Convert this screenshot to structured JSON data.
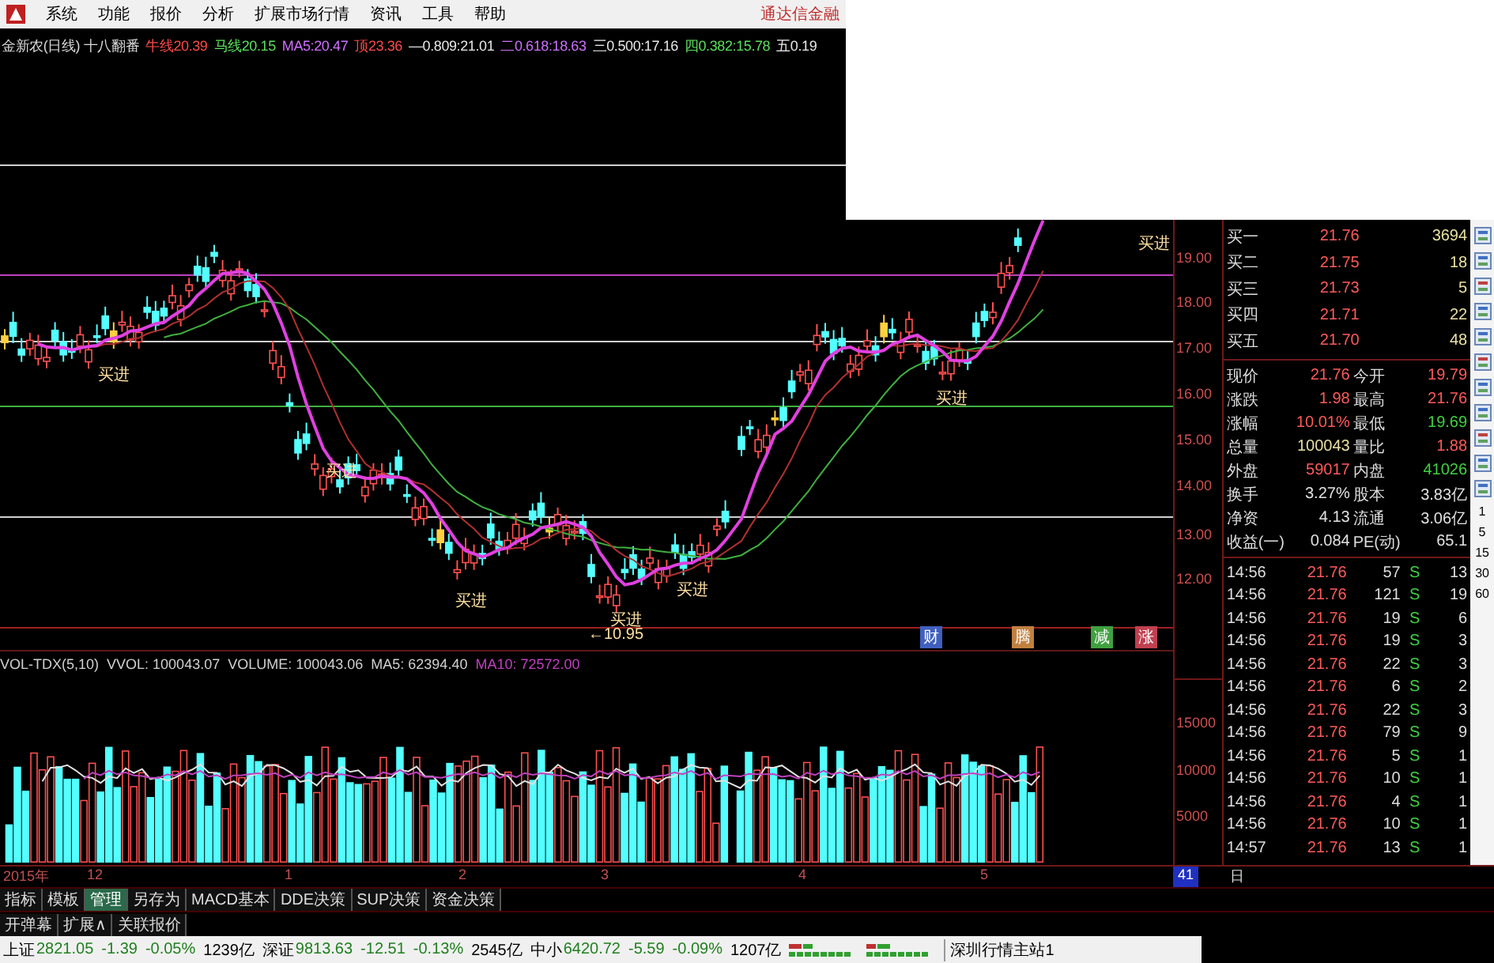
{
  "menu": {
    "items": [
      "系统",
      "功能",
      "报价",
      "分析",
      "扩展市场行情",
      "资讯",
      "工具",
      "帮助"
    ],
    "brand": "通达信金融"
  },
  "info_line": [
    {
      "label": "金新农(日线) 十八翻番",
      "color": "#d8d8d8"
    },
    {
      "label": "牛线",
      "value": "20.39",
      "color": "#ff4a4a"
    },
    {
      "label": "马线",
      "value": "20.15",
      "color": "#5be05b"
    },
    {
      "label": "MA5:",
      "value": "20.47",
      "color": "#d070ff"
    },
    {
      "label": "顶",
      "value": "23.36",
      "color": "#ff4a4a"
    },
    {
      "label": "—0.809:",
      "value": "21.01",
      "color": "#e8e8e8"
    },
    {
      "label": "二0.618:",
      "value": "18.63",
      "color": "#d070ff"
    },
    {
      "label": "三0.500:",
      "value": "17.16",
      "color": "#e8e8e8"
    },
    {
      "label": "四0.382:",
      "value": "15.78",
      "color": "#5be05b"
    },
    {
      "label": "五0.19",
      "color": "#e8e8e8"
    }
  ],
  "price_axis": [
    "19.00",
    "18.00",
    "17.00",
    "16.00",
    "15.00",
    "14.00",
    "13.00",
    "12.00"
  ],
  "chart_labels": [
    "买进",
    "买进",
    "买进",
    "买进",
    "买进",
    "买进",
    "买进",
    "←10.95"
  ],
  "event_markers": [
    {
      "text": "财",
      "color": "#4060c0"
    },
    {
      "text": "腾",
      "color": "#c08040"
    },
    {
      "text": "减",
      "color": "#40a040"
    },
    {
      "text": "涨",
      "color": "#c04050"
    }
  ],
  "volume_header": [
    {
      "text": "VOL-TDX(5,10)",
      "color": "#d0d0d0"
    },
    {
      "text": "VVOL: 100043.07",
      "color": "#d0d0d0"
    },
    {
      "text": "VOLUME: 100043.06",
      "color": "#d0d0d0"
    },
    {
      "text": "MA5: 62394.40",
      "color": "#d0d0d0"
    },
    {
      "text": "MA10: 72572.00",
      "color": "#c040c0"
    }
  ],
  "volume_axis": [
    "15000",
    "10000",
    "5000"
  ],
  "time_axis": [
    "2015年",
    "12",
    "1",
    "2",
    "3",
    "4",
    "5"
  ],
  "period_box": "41",
  "period_unit": "日",
  "order_book": [
    {
      "label": "买一",
      "price": "21.76",
      "volume": "3694"
    },
    {
      "label": "买二",
      "price": "21.75",
      "volume": "18"
    },
    {
      "label": "买三",
      "price": "21.73",
      "volume": "5"
    },
    {
      "label": "买四",
      "price": "21.71",
      "volume": "22"
    },
    {
      "label": "买五",
      "price": "21.70",
      "volume": "48"
    }
  ],
  "stats": [
    {
      "label": "现价",
      "value": {
        "text": "21.76",
        "color": "#ff5a5a"
      },
      "label2": "今开",
      "value2": {
        "text": "19.79",
        "color": "#ff5a5a"
      }
    },
    {
      "label": "涨跌",
      "value": {
        "text": "1.98",
        "color": "#ff5a5a"
      },
      "label2": "最高",
      "value2": {
        "text": "21.76",
        "color": "#ff5a5a"
      }
    },
    {
      "label": "涨幅",
      "value": {
        "text": "10.01%",
        "color": "#ff5a5a"
      },
      "label2": "最低",
      "value2": {
        "text": "19.69",
        "color": "#40d040"
      }
    },
    {
      "label": "总量",
      "value": {
        "text": "100043",
        "color": "#e8e0a0"
      },
      "label2": "量比",
      "value2": {
        "text": "1.88",
        "color": "#ff5a5a"
      }
    },
    {
      "label": "外盘",
      "value": {
        "text": "59017",
        "color": "#ff5a5a"
      },
      "label2": "内盘",
      "value2": {
        "text": "41026",
        "color": "#40d040"
      }
    },
    {
      "label": "换手",
      "value": {
        "text": "3.27%",
        "color": "#e0e0e0"
      },
      "label2": "股本",
      "value2": {
        "text": "3.83亿",
        "color": "#e0e0e0"
      }
    },
    {
      "label": "净资",
      "value": {
        "text": "4.13",
        "color": "#e0e0e0"
      },
      "label2": "流通",
      "value2": {
        "text": "3.06亿",
        "color": "#e0e0e0"
      }
    },
    {
      "label": "收益(一)",
      "value": {
        "text": "0.084",
        "color": "#e0e0e0"
      },
      "label2": "PE(动)",
      "value2": {
        "text": "65.1",
        "color": "#e0e0e0"
      }
    }
  ],
  "ticks": [
    {
      "time": "14:56",
      "price": "21.76",
      "volume": "57",
      "side": "S",
      "color": "#40d040",
      "count": "13"
    },
    {
      "time": "14:56",
      "price": "21.76",
      "volume": "121",
      "side": "S",
      "color": "#40d040",
      "count": "19"
    },
    {
      "time": "14:56",
      "price": "21.76",
      "volume": "19",
      "side": "S",
      "color": "#40d040",
      "count": "6"
    },
    {
      "time": "14:56",
      "price": "21.76",
      "volume": "19",
      "side": "S",
      "color": "#40d040",
      "count": "3"
    },
    {
      "time": "14:56",
      "price": "21.76",
      "volume": "22",
      "side": "S",
      "color": "#40d040",
      "count": "3"
    },
    {
      "time": "14:56",
      "price": "21.76",
      "volume": "6",
      "side": "S",
      "color": "#40d040",
      "count": "2"
    },
    {
      "time": "14:56",
      "price": "21.76",
      "volume": "22",
      "side": "S",
      "color": "#40d040",
      "count": "3"
    },
    {
      "time": "14:56",
      "price": "21.76",
      "volume": "79",
      "side": "S",
      "color": "#40d040",
      "count": "9"
    },
    {
      "time": "14:56",
      "price": "21.76",
      "volume": "5",
      "side": "S",
      "color": "#40d040",
      "count": "1"
    },
    {
      "time": "14:56",
      "price": "21.76",
      "volume": "10",
      "side": "S",
      "color": "#40d040",
      "count": "1"
    },
    {
      "time": "14:56",
      "price": "21.76",
      "volume": "4",
      "side": "S",
      "color": "#40d040",
      "count": "1"
    },
    {
      "time": "14:56",
      "price": "21.76",
      "volume": "10",
      "side": "S",
      "color": "#40d040",
      "count": "1"
    },
    {
      "time": "14:57",
      "price": "21.76",
      "volume": "13",
      "side": "S",
      "color": "#40d040",
      "count": "1"
    }
  ],
  "side_toolbar": {
    "periods": [
      "1",
      "5",
      "15",
      "30",
      "60"
    ]
  },
  "tabs": [
    {
      "label": "指标",
      "selected": false
    },
    {
      "label": "模板",
      "selected": false
    },
    {
      "label": "管理",
      "selected": true
    },
    {
      "label": "另存为",
      "selected": false
    },
    {
      "label": "MACD基本",
      "selected": false
    },
    {
      "label": "DDE决策",
      "selected": false
    },
    {
      "label": "SUP决策",
      "selected": false
    },
    {
      "label": "资金决策",
      "selected": false
    }
  ],
  "subtabs": [
    "开弹幕",
    "扩展∧",
    "关联报价"
  ],
  "status_bar": {
    "indices": [
      {
        "name": "上证",
        "value": "2821.05",
        "change": "-1.39",
        "percent": "-0.05%",
        "amount": "1239亿"
      },
      {
        "name": "深证",
        "value": "9813.63",
        "change": "-12.51",
        "percent": "-0.13%",
        "amount": "2545亿"
      },
      {
        "name": "中小",
        "value": "6420.72",
        "change": "-5.59",
        "percent": "-0.09%",
        "amount": "1207亿"
      }
    ],
    "server": "深圳行情主站1"
  }
}
